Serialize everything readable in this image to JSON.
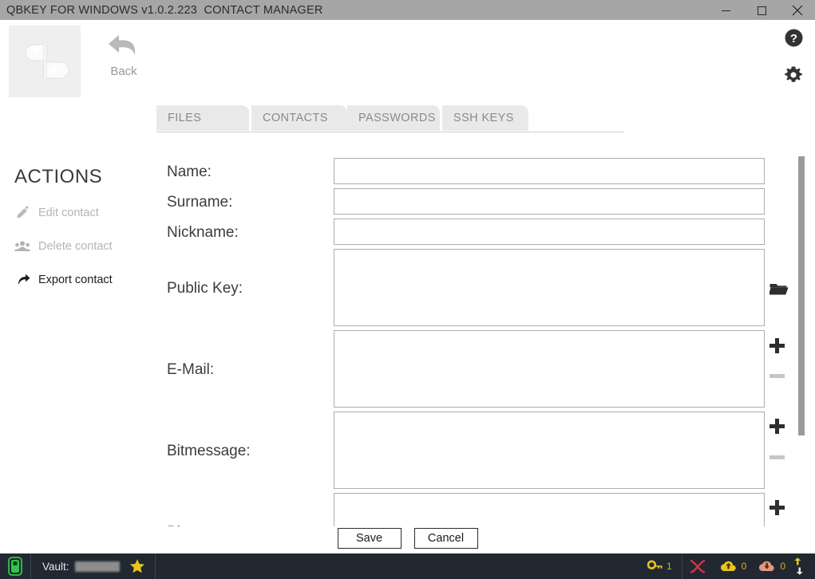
{
  "window": {
    "title": "QBKEY FOR WINDOWS v1.0.2.223  CONTACT MANAGER",
    "controls": {
      "minimize": "minimize-icon",
      "maximize": "maximize-icon",
      "close": "close-icon"
    }
  },
  "topbar": {
    "logo": "qbkey-logo-icon",
    "back": {
      "label": "Back",
      "icon": "back-arrow-icon"
    },
    "help_icon": "help-circle-icon",
    "settings_icon": "gear-icon"
  },
  "tabs": [
    {
      "label": "FILES",
      "active": false
    },
    {
      "label": "CONTACTS",
      "active": false
    },
    {
      "label": "PASSWORDS",
      "active": false
    },
    {
      "label": "SSH KEYS",
      "active": false
    }
  ],
  "sidebar": {
    "title": "ACTIONS",
    "items": [
      {
        "label": "Edit contact",
        "icon": "pencil-icon",
        "enabled": false
      },
      {
        "label": "Delete contact",
        "icon": "people-icon",
        "enabled": false
      },
      {
        "label": "Export contact",
        "icon": "export-arrow-icon",
        "enabled": true
      }
    ]
  },
  "form": {
    "fields": [
      {
        "label": "Name:",
        "value": "",
        "placeholder": ""
      },
      {
        "label": "Surname:",
        "value": "",
        "placeholder": ""
      },
      {
        "label": "Nickname:",
        "value": "",
        "placeholder": ""
      },
      {
        "label": "Public Key:",
        "value": "",
        "placeholder": ""
      },
      {
        "label": "E-Mail:",
        "value": "",
        "placeholder": ""
      },
      {
        "label": "Bitmessage:",
        "value": "",
        "placeholder": ""
      },
      {
        "label": "Ph",
        "value": "",
        "placeholder": ""
      }
    ],
    "side_icons": [
      {
        "name": "browse-folder-icon",
        "glyph": "folder"
      },
      {
        "name": "add-email-icon",
        "glyph": "plus"
      },
      {
        "name": "remove-email-icon",
        "glyph": "minus"
      },
      {
        "name": "add-bitmessage-icon",
        "glyph": "plus"
      },
      {
        "name": "remove-bitmessage-icon",
        "glyph": "minus"
      },
      {
        "name": "add-phone-icon",
        "glyph": "plus"
      }
    ]
  },
  "footer": {
    "save_label": "Save",
    "cancel_label": "Cancel"
  },
  "statusbar": {
    "device_icon": "usb-device-icon",
    "vault_label": "Vault:",
    "vault_value": "",
    "favorite_icon": "star-icon",
    "key_icon": "key-icon",
    "key_count": "1",
    "link_icon": "broken-link-icon",
    "upload_icon": "cloud-upload-icon",
    "upload_count": "0",
    "download_icon": "cloud-download-icon",
    "download_count": "0",
    "transfer_icon": "up-down-arrows-icon"
  },
  "colors": {
    "titlebar": "#a6a6a6",
    "statusbar": "#222831",
    "accent_green": "#2fc64a",
    "accent_gold": "#e8c51f",
    "accent_red": "#d1344a"
  }
}
